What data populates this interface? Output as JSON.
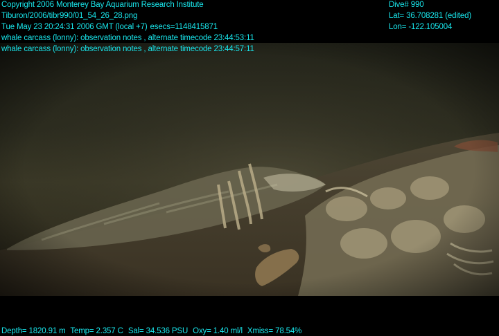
{
  "overlay": {
    "copyright": "Copyright 2006 Monterey Bay Aquarium Research Institute",
    "file_path": "Tiburon/2006/tibr990/01_54_26_28.png",
    "datetime": "Tue May 23 20:24:31 2006 GMT (local +7)",
    "esecs": "esecs=1148415871",
    "note_1": "whale carcass (lonny): observation notes , alternate timecode 23:44:53:11",
    "note_2": "whale carcass (lonny): observation notes , alternate timecode 23:44:57:11",
    "dive": "Dive# 990",
    "lat": "Lat= 36.708281 (edited)",
    "lon": "Lon= -122.105004",
    "depth": "Depth= 1820.91 m",
    "temp": "Temp= 2.357 C",
    "sal": "Sal= 34.536 PSU",
    "oxy": "Oxy= 1.40 ml/l",
    "xmiss": "Xmiss= 78.54%"
  },
  "colors": {
    "overlay_text": "#19e6ec",
    "water": "#2c2a1c",
    "sediment": "#4a4230",
    "bone": "#b9ac88"
  }
}
